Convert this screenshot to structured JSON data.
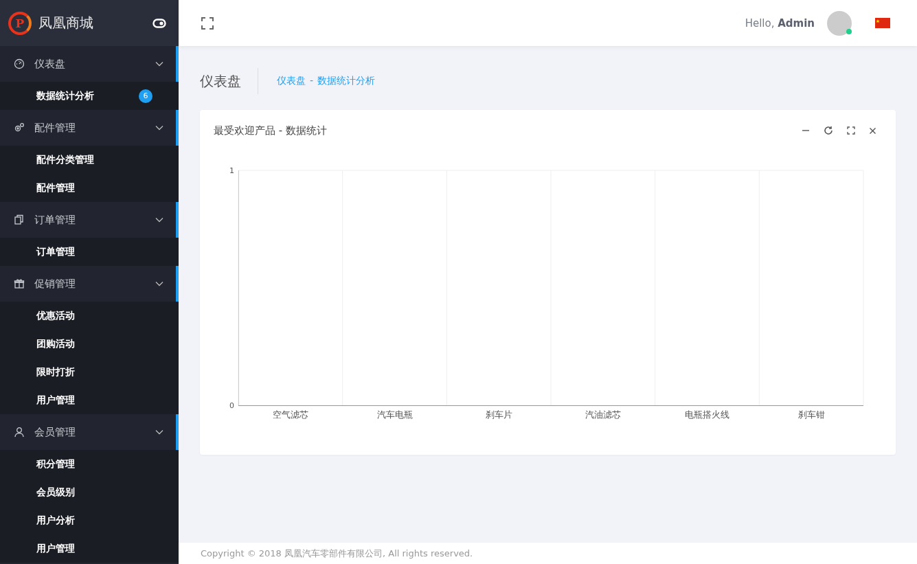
{
  "brand": {
    "mark": "P",
    "name": "凤凰商城"
  },
  "sidebar": {
    "groups": [
      {
        "label": "仪表盘",
        "expanded": true,
        "children": [
          {
            "label": "数据统计分析",
            "badge": "6"
          }
        ]
      },
      {
        "label": "配件管理",
        "expanded": true,
        "children": [
          {
            "label": "配件分类管理"
          },
          {
            "label": "配件管理"
          }
        ]
      },
      {
        "label": "订单管理",
        "expanded": true,
        "children": [
          {
            "label": "订单管理"
          }
        ]
      },
      {
        "label": "促销管理",
        "expanded": true,
        "children": [
          {
            "label": "优惠活动"
          },
          {
            "label": "团购活动"
          },
          {
            "label": "限时打折"
          },
          {
            "label": "用户管理"
          }
        ]
      },
      {
        "label": "会员管理",
        "expanded": true,
        "children": [
          {
            "label": "积分管理"
          },
          {
            "label": "会员级别"
          },
          {
            "label": "用户分析"
          },
          {
            "label": "用户管理"
          }
        ]
      }
    ]
  },
  "header": {
    "greeting": "Hello,",
    "user": "Admin",
    "online": true
  },
  "page": {
    "title": "仪表盘",
    "breadcrumb": [
      "仪表盘",
      "数据统计分析"
    ],
    "breadcrumb_separator": "-"
  },
  "card": {
    "title": "最受欢迎产品 - 数据统计",
    "chart_data": {
      "type": "bar",
      "categories": [
        "空气滤芯",
        "汽车电瓶",
        "刹车片",
        "汽油滤芯",
        "电瓶搭火线",
        "刹车钳"
      ],
      "values": [
        0,
        0,
        0,
        0,
        0,
        0
      ],
      "ylim": [
        0,
        1
      ],
      "yticks": [
        0,
        1
      ]
    }
  },
  "footer": {
    "text": "Copyright © 2018 凤凰汽车零部件有限公司, All rights reserved."
  }
}
